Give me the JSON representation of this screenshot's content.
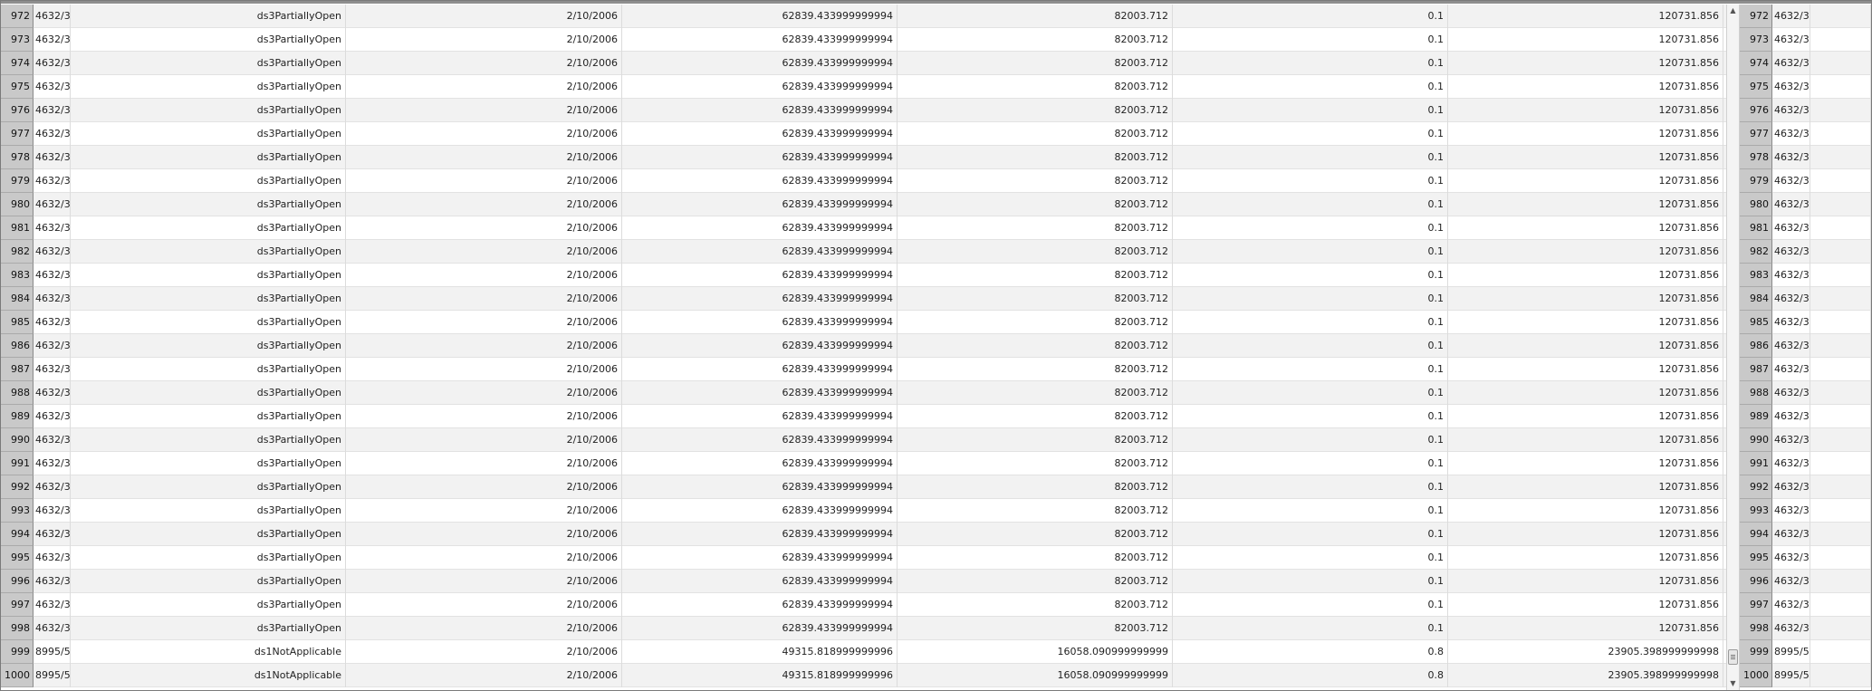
{
  "colors": {
    "row_header_bg": "#c9c9c9",
    "alt_row_bg": "#f2f2f2",
    "grid_line": "#dcdcdc"
  },
  "icons": {
    "scroll_up": "triangle-up-icon",
    "scroll_down": "triangle-down-icon",
    "scroll_thumb": "grip-lines-icon"
  },
  "scrollbar": {
    "up_glyph": "▲",
    "down_glyph": "▼",
    "position_fraction": 0.98
  },
  "rows": [
    {
      "rn": "972",
      "id": "4632/3",
      "status": "ds3PartiallyOpen",
      "date": "2/10/2006",
      "v1": "62839.433999999994",
      "v2": "82003.712",
      "v3": "0.1",
      "v4": "120731.856",
      "rn2": "972",
      "id2": "4632/3"
    },
    {
      "rn": "973",
      "id": "4632/3",
      "status": "ds3PartiallyOpen",
      "date": "2/10/2006",
      "v1": "62839.433999999994",
      "v2": "82003.712",
      "v3": "0.1",
      "v4": "120731.856",
      "rn2": "973",
      "id2": "4632/3"
    },
    {
      "rn": "974",
      "id": "4632/3",
      "status": "ds3PartiallyOpen",
      "date": "2/10/2006",
      "v1": "62839.433999999994",
      "v2": "82003.712",
      "v3": "0.1",
      "v4": "120731.856",
      "rn2": "974",
      "id2": "4632/3"
    },
    {
      "rn": "975",
      "id": "4632/3",
      "status": "ds3PartiallyOpen",
      "date": "2/10/2006",
      "v1": "62839.433999999994",
      "v2": "82003.712",
      "v3": "0.1",
      "v4": "120731.856",
      "rn2": "975",
      "id2": "4632/3"
    },
    {
      "rn": "976",
      "id": "4632/3",
      "status": "ds3PartiallyOpen",
      "date": "2/10/2006",
      "v1": "62839.433999999994",
      "v2": "82003.712",
      "v3": "0.1",
      "v4": "120731.856",
      "rn2": "976",
      "id2": "4632/3"
    },
    {
      "rn": "977",
      "id": "4632/3",
      "status": "ds3PartiallyOpen",
      "date": "2/10/2006",
      "v1": "62839.433999999994",
      "v2": "82003.712",
      "v3": "0.1",
      "v4": "120731.856",
      "rn2": "977",
      "id2": "4632/3"
    },
    {
      "rn": "978",
      "id": "4632/3",
      "status": "ds3PartiallyOpen",
      "date": "2/10/2006",
      "v1": "62839.433999999994",
      "v2": "82003.712",
      "v3": "0.1",
      "v4": "120731.856",
      "rn2": "978",
      "id2": "4632/3"
    },
    {
      "rn": "979",
      "id": "4632/3",
      "status": "ds3PartiallyOpen",
      "date": "2/10/2006",
      "v1": "62839.433999999994",
      "v2": "82003.712",
      "v3": "0.1",
      "v4": "120731.856",
      "rn2": "979",
      "id2": "4632/3"
    },
    {
      "rn": "980",
      "id": "4632/3",
      "status": "ds3PartiallyOpen",
      "date": "2/10/2006",
      "v1": "62839.433999999994",
      "v2": "82003.712",
      "v3": "0.1",
      "v4": "120731.856",
      "rn2": "980",
      "id2": "4632/3"
    },
    {
      "rn": "981",
      "id": "4632/3",
      "status": "ds3PartiallyOpen",
      "date": "2/10/2006",
      "v1": "62839.433999999994",
      "v2": "82003.712",
      "v3": "0.1",
      "v4": "120731.856",
      "rn2": "981",
      "id2": "4632/3"
    },
    {
      "rn": "982",
      "id": "4632/3",
      "status": "ds3PartiallyOpen",
      "date": "2/10/2006",
      "v1": "62839.433999999994",
      "v2": "82003.712",
      "v3": "0.1",
      "v4": "120731.856",
      "rn2": "982",
      "id2": "4632/3"
    },
    {
      "rn": "983",
      "id": "4632/3",
      "status": "ds3PartiallyOpen",
      "date": "2/10/2006",
      "v1": "62839.433999999994",
      "v2": "82003.712",
      "v3": "0.1",
      "v4": "120731.856",
      "rn2": "983",
      "id2": "4632/3"
    },
    {
      "rn": "984",
      "id": "4632/3",
      "status": "ds3PartiallyOpen",
      "date": "2/10/2006",
      "v1": "62839.433999999994",
      "v2": "82003.712",
      "v3": "0.1",
      "v4": "120731.856",
      "rn2": "984",
      "id2": "4632/3"
    },
    {
      "rn": "985",
      "id": "4632/3",
      "status": "ds3PartiallyOpen",
      "date": "2/10/2006",
      "v1": "62839.433999999994",
      "v2": "82003.712",
      "v3": "0.1",
      "v4": "120731.856",
      "rn2": "985",
      "id2": "4632/3"
    },
    {
      "rn": "986",
      "id": "4632/3",
      "status": "ds3PartiallyOpen",
      "date": "2/10/2006",
      "v1": "62839.433999999994",
      "v2": "82003.712",
      "v3": "0.1",
      "v4": "120731.856",
      "rn2": "986",
      "id2": "4632/3"
    },
    {
      "rn": "987",
      "id": "4632/3",
      "status": "ds3PartiallyOpen",
      "date": "2/10/2006",
      "v1": "62839.433999999994",
      "v2": "82003.712",
      "v3": "0.1",
      "v4": "120731.856",
      "rn2": "987",
      "id2": "4632/3"
    },
    {
      "rn": "988",
      "id": "4632/3",
      "status": "ds3PartiallyOpen",
      "date": "2/10/2006",
      "v1": "62839.433999999994",
      "v2": "82003.712",
      "v3": "0.1",
      "v4": "120731.856",
      "rn2": "988",
      "id2": "4632/3"
    },
    {
      "rn": "989",
      "id": "4632/3",
      "status": "ds3PartiallyOpen",
      "date": "2/10/2006",
      "v1": "62839.433999999994",
      "v2": "82003.712",
      "v3": "0.1",
      "v4": "120731.856",
      "rn2": "989",
      "id2": "4632/3"
    },
    {
      "rn": "990",
      "id": "4632/3",
      "status": "ds3PartiallyOpen",
      "date": "2/10/2006",
      "v1": "62839.433999999994",
      "v2": "82003.712",
      "v3": "0.1",
      "v4": "120731.856",
      "rn2": "990",
      "id2": "4632/3"
    },
    {
      "rn": "991",
      "id": "4632/3",
      "status": "ds3PartiallyOpen",
      "date": "2/10/2006",
      "v1": "62839.433999999994",
      "v2": "82003.712",
      "v3": "0.1",
      "v4": "120731.856",
      "rn2": "991",
      "id2": "4632/3"
    },
    {
      "rn": "992",
      "id": "4632/3",
      "status": "ds3PartiallyOpen",
      "date": "2/10/2006",
      "v1": "62839.433999999994",
      "v2": "82003.712",
      "v3": "0.1",
      "v4": "120731.856",
      "rn2": "992",
      "id2": "4632/3"
    },
    {
      "rn": "993",
      "id": "4632/3",
      "status": "ds3PartiallyOpen",
      "date": "2/10/2006",
      "v1": "62839.433999999994",
      "v2": "82003.712",
      "v3": "0.1",
      "v4": "120731.856",
      "rn2": "993",
      "id2": "4632/3"
    },
    {
      "rn": "994",
      "id": "4632/3",
      "status": "ds3PartiallyOpen",
      "date": "2/10/2006",
      "v1": "62839.433999999994",
      "v2": "82003.712",
      "v3": "0.1",
      "v4": "120731.856",
      "rn2": "994",
      "id2": "4632/3"
    },
    {
      "rn": "995",
      "id": "4632/3",
      "status": "ds3PartiallyOpen",
      "date": "2/10/2006",
      "v1": "62839.433999999994",
      "v2": "82003.712",
      "v3": "0.1",
      "v4": "120731.856",
      "rn2": "995",
      "id2": "4632/3"
    },
    {
      "rn": "996",
      "id": "4632/3",
      "status": "ds3PartiallyOpen",
      "date": "2/10/2006",
      "v1": "62839.433999999994",
      "v2": "82003.712",
      "v3": "0.1",
      "v4": "120731.856",
      "rn2": "996",
      "id2": "4632/3"
    },
    {
      "rn": "997",
      "id": "4632/3",
      "status": "ds3PartiallyOpen",
      "date": "2/10/2006",
      "v1": "62839.433999999994",
      "v2": "82003.712",
      "v3": "0.1",
      "v4": "120731.856",
      "rn2": "997",
      "id2": "4632/3"
    },
    {
      "rn": "998",
      "id": "4632/3",
      "status": "ds3PartiallyOpen",
      "date": "2/10/2006",
      "v1": "62839.433999999994",
      "v2": "82003.712",
      "v3": "0.1",
      "v4": "120731.856",
      "rn2": "998",
      "id2": "4632/3"
    },
    {
      "rn": "999",
      "id": "8995/5",
      "status": "ds1NotApplicable",
      "date": "2/10/2006",
      "v1": "49315.818999999996",
      "v2": "16058.090999999999",
      "v3": "0.8",
      "v4": "23905.398999999998",
      "rn2": "999",
      "id2": "8995/5"
    },
    {
      "rn": "1000",
      "id": "8995/5",
      "status": "ds1NotApplicable",
      "date": "2/10/2006",
      "v1": "49315.818999999996",
      "v2": "16058.090999999999",
      "v3": "0.8",
      "v4": "23905.398999999998",
      "rn2": "1000",
      "id2": "8995/5"
    }
  ]
}
